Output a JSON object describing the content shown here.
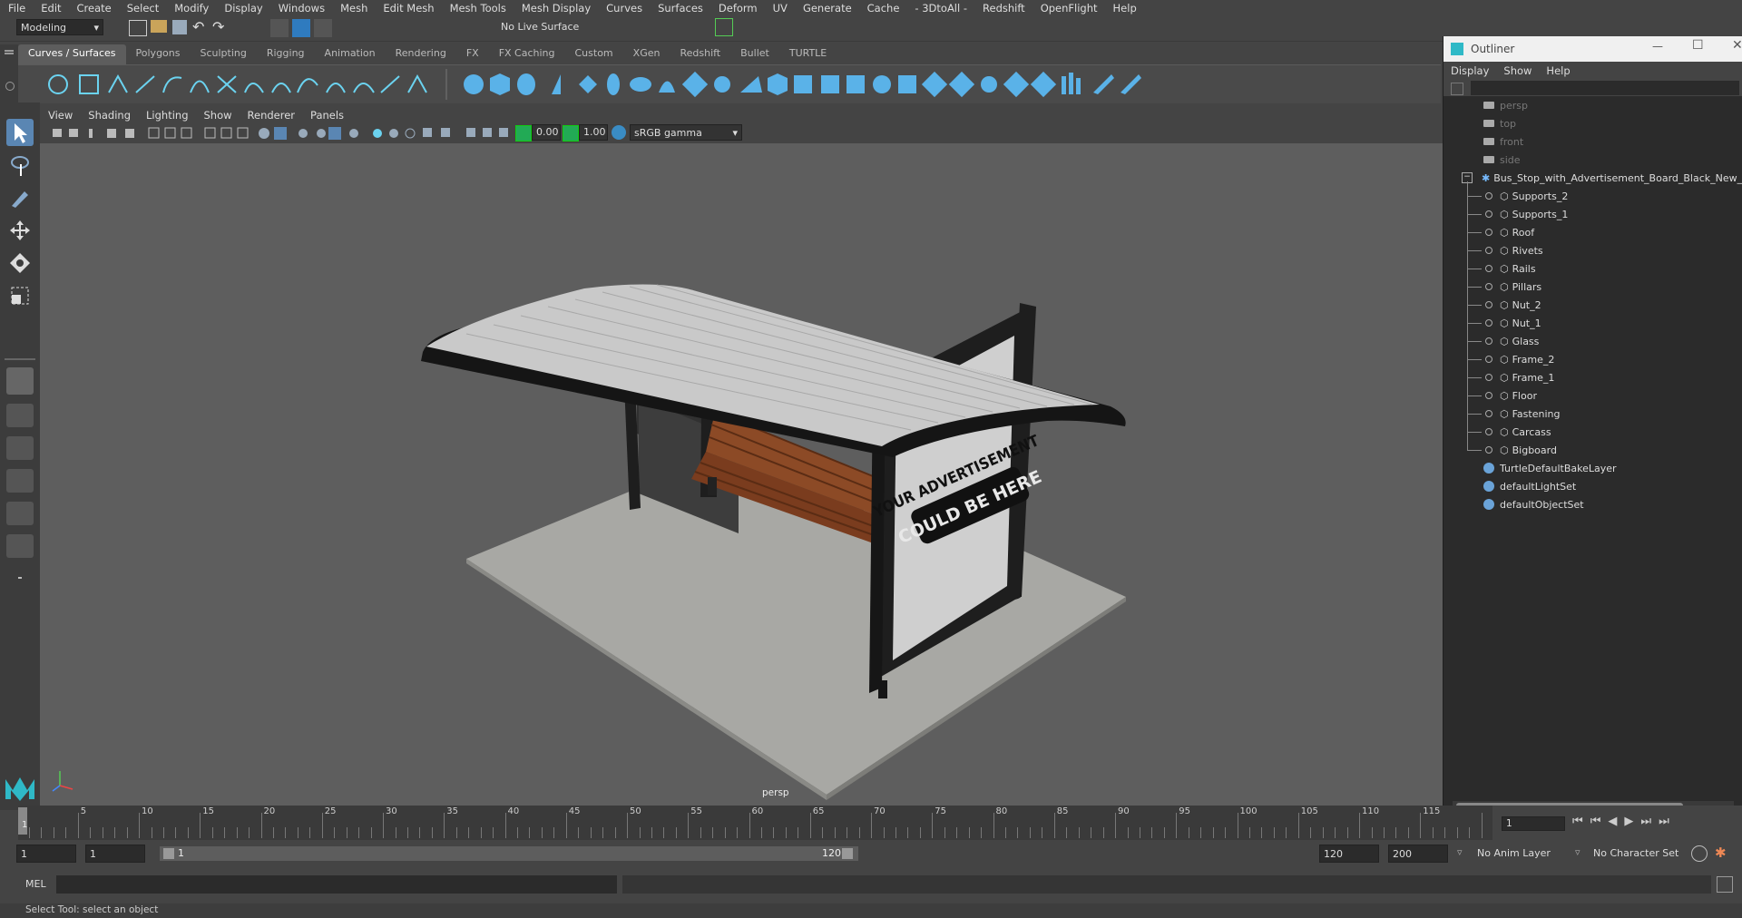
{
  "menubar": [
    "File",
    "Edit",
    "Create",
    "Select",
    "Modify",
    "Display",
    "Windows",
    "Mesh",
    "Edit Mesh",
    "Mesh Tools",
    "Mesh Display",
    "Curves",
    "Surfaces",
    "Deform",
    "UV",
    "Generate",
    "Cache",
    "- 3DtoAll -",
    "Redshift",
    "OpenFlight",
    "Help"
  ],
  "statusline": {
    "workspace": "Modeling",
    "live_surface": "No Live Surface"
  },
  "shelf_tabs": [
    "Curves / Surfaces",
    "Polygons",
    "Sculpting",
    "Rigging",
    "Animation",
    "Rendering",
    "FX",
    "FX Caching",
    "Custom",
    "XGen",
    "Redshift",
    "Bullet",
    "TURTLE"
  ],
  "panel_menu": [
    "View",
    "Shading",
    "Lighting",
    "Show",
    "Renderer",
    "Panels"
  ],
  "panel_toolbar": {
    "exposure": "0.00",
    "gamma": "1.00",
    "colorspace": "sRGB gamma"
  },
  "viewport": {
    "camera_label": "persp",
    "billboard_line1": "YOUR ADVERTISEMENT",
    "billboard_line2": "COULD BE HERE"
  },
  "outliner": {
    "title": "Outliner",
    "menu": [
      "Display",
      "Show",
      "Help"
    ],
    "cameras": [
      "persp",
      "top",
      "front",
      "side"
    ],
    "group": "Bus_Stop_with_Advertisement_Board_Black_New_nc",
    "children": [
      "Supports_2",
      "Supports_1",
      "Roof",
      "Rivets",
      "Rails",
      "Pillars",
      "Nut_2",
      "Nut_1",
      "Glass",
      "Frame_2",
      "Frame_1",
      "Floor",
      "Fastening",
      "Carcass",
      "Bigboard"
    ],
    "sets": [
      "TurtleDefaultBakeLayer",
      "defaultLightSet",
      "defaultObjectSet"
    ]
  },
  "timeline": {
    "ticks": [
      "5",
      "10",
      "15",
      "20",
      "25",
      "30",
      "35",
      "40",
      "45",
      "50",
      "55",
      "60",
      "65",
      "70",
      "75",
      "80",
      "85",
      "90",
      "95",
      "100",
      "105",
      "110",
      "115"
    ],
    "current_frame": "1",
    "first_tick": "1",
    "frame_field": "1"
  },
  "range": {
    "start": "1",
    "start2": "1",
    "slider_start": "1",
    "slider_end": "120",
    "end": "120",
    "end2": "200",
    "anim_layer": "No Anim Layer",
    "char_set": "No Character Set"
  },
  "cmd": {
    "label": "MEL"
  },
  "helpline": "Select Tool: select an object"
}
